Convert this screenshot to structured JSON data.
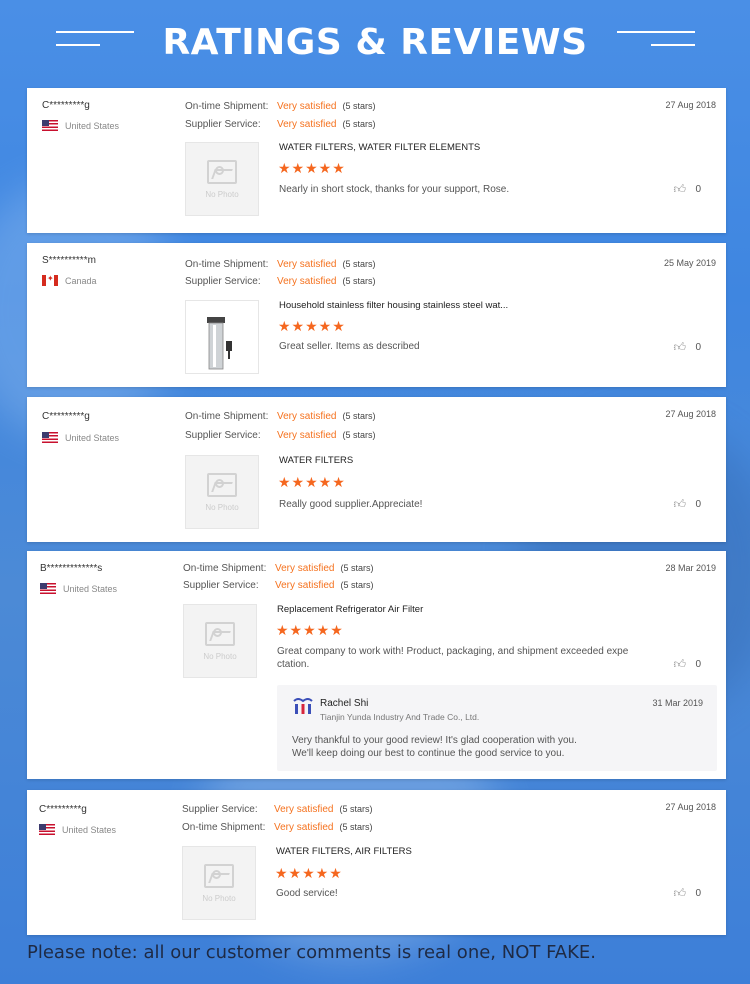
{
  "header": {
    "title": "RATINGS & REVIEWS"
  },
  "labels": {
    "ontime": "On-time Shipment:",
    "supplier": "Supplier Service:",
    "no_photo": "No Photo"
  },
  "reviews": [
    {
      "user": "C*********g",
      "country": "United States",
      "date": "27 Aug 2018",
      "ontime_value": "Very satisfied",
      "ontime_stars": "(5 stars)",
      "supplier_value": "Very satisfied",
      "supplier_stars": "(5 stars)",
      "product": "WATER FILTERS, WATER FILTER ELEMENTS",
      "rating": "★★★★★",
      "comment": "Nearly in short stock, thanks for your support, Rose.",
      "likes": "0"
    },
    {
      "user": "S**********m",
      "country": "Canada",
      "date": "25 May 2019",
      "ontime_value": "Very satisfied",
      "ontime_stars": "(5 stars)",
      "supplier_value": "Very satisfied",
      "supplier_stars": "(5 stars)",
      "product": "Household stainless filter housing stainless steel wat...",
      "rating": "★★★★★",
      "comment": "Great seller. Items as described",
      "likes": "0"
    },
    {
      "user": "C*********g",
      "country": "United States",
      "date": "27 Aug 2018",
      "ontime_value": "Very satisfied",
      "ontime_stars": "(5 stars)",
      "supplier_value": "Very satisfied",
      "supplier_stars": "(5 stars)",
      "product": "WATER FILTERS",
      "rating": "★★★★★",
      "comment": "Really good supplier.Appreciate!",
      "likes": "0"
    },
    {
      "user": "B*************s",
      "country": "United States",
      "date": "28 Mar 2019",
      "ontime_value": "Very satisfied",
      "ontime_stars": "(5 stars)",
      "supplier_value": "Very satisfied",
      "supplier_stars": "(5 stars)",
      "product": "Replacement Refrigerator Air Filter",
      "rating": "★★★★★",
      "comment_line1": "Great company to work with! Product, packaging, and shipment exceeded expe",
      "comment_line2": "ctation.",
      "likes": "0",
      "reply": {
        "name": "Rachel Shi",
        "company": "Tianjin Yunda Industry And Trade Co., Ltd.",
        "date": "31 Mar 2019",
        "line1": "Very thankful to your good review! It's glad cooperation with you.",
        "line2": "We'll keep doing our best to continue the good service to you."
      }
    },
    {
      "user": "C*********g",
      "country": "United States",
      "date": "27 Aug 2018",
      "supplier_value": "Very satisfied",
      "supplier_stars": "(5 stars)",
      "ontime_value": "Very satisfied",
      "ontime_stars": "(5 stars)",
      "product": "WATER FILTERS, AIR FILTERS",
      "rating": "★★★★★",
      "comment": "Good service!",
      "likes": "0"
    }
  ],
  "footer": {
    "note": "Please note: all our customer comments is real one, NOT FAKE."
  },
  "colors": {
    "accent": "#f5721f",
    "star": "#f5671f",
    "background": "#4a8fe6"
  }
}
